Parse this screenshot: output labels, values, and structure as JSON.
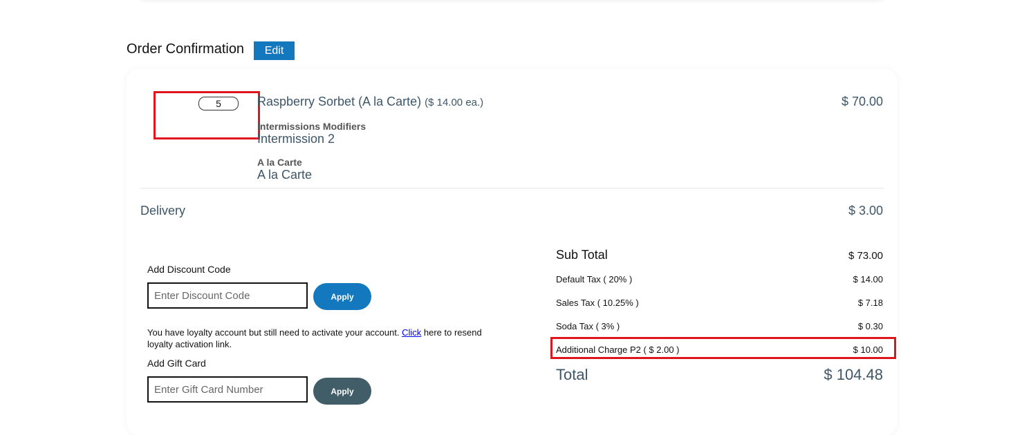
{
  "order": {
    "title": "Order Confirmation",
    "edit_label": "Edit"
  },
  "item": {
    "quantity": "5",
    "name": "Raspberry Sorbet (A la Carte)",
    "price_each": "($ 14.00 ea.)",
    "total": "$ 70.00",
    "modifiers": [
      {
        "label": "Intermissions Modifiers",
        "value": "Intermission 2"
      },
      {
        "label": "A la Carte",
        "value": "A la Carte"
      }
    ]
  },
  "delivery": {
    "label": "Delivery",
    "price": "$ 3.00"
  },
  "discount": {
    "label": "Add Discount Code",
    "placeholder": "Enter Discount Code",
    "apply_label": "Apply"
  },
  "loyalty": {
    "text_before": "You have loyalty account but still need to activate your account. ",
    "link_text": "Click",
    "text_after": " here to resend loyalty activation link."
  },
  "gift_card": {
    "label": "Add Gift Card",
    "placeholder": "Enter Gift Card Number",
    "apply_label": "Apply"
  },
  "summary": {
    "subtotal_label": "Sub Total",
    "subtotal_value": "$ 73.00",
    "taxes": [
      {
        "label": "Default Tax ( 20% )",
        "value": "$ 14.00"
      },
      {
        "label": "Sales Tax ( 10.25% )",
        "value": "$ 7.18"
      },
      {
        "label": "Soda Tax ( 3% )",
        "value": "$ 0.30"
      },
      {
        "label": "Additional Charge P2 ( $ 2.00 )",
        "value": "$ 10.00"
      }
    ],
    "total_label": "Total",
    "total_value": "$ 104.48"
  },
  "colors": {
    "accent": "#1478be",
    "dark_button": "#415d67",
    "highlight": "#e0151c",
    "text_slate": "#3d5668"
  }
}
